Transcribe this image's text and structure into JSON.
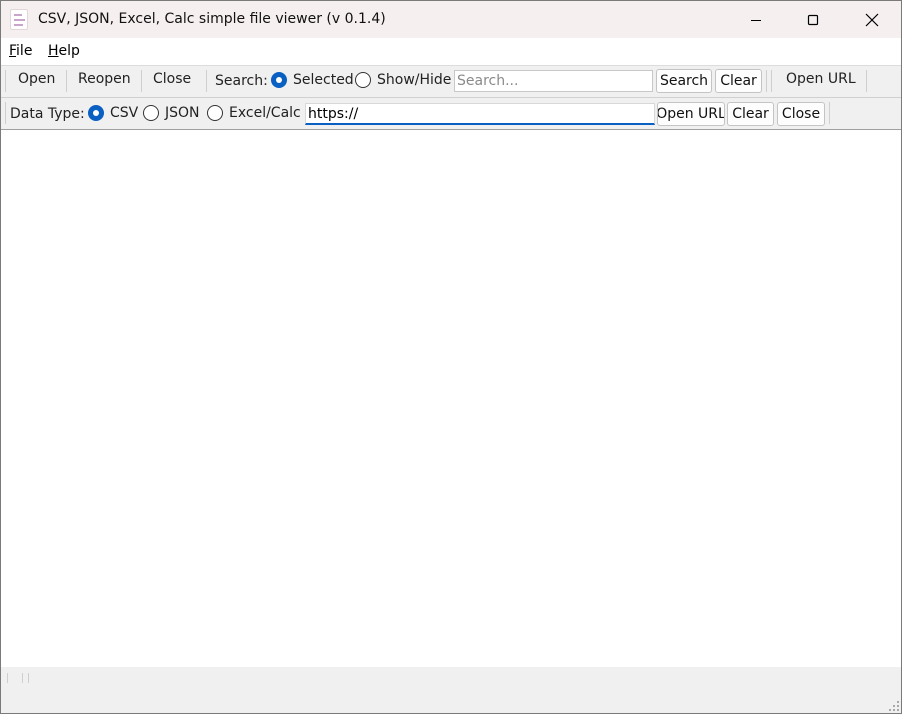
{
  "window": {
    "title": "CSV, JSON, Excel, Calc simple file viewer (v 0.1.4)"
  },
  "title_buttons": {
    "minimize": "minimize-icon",
    "maximize": "maximize-icon",
    "close": "close-icon"
  },
  "menu": {
    "file_u": "F",
    "file_rest": "ile",
    "help_u": "H",
    "help_rest": "elp"
  },
  "toolbar1": {
    "open": "Open",
    "reopen": "Reopen",
    "close": "Close",
    "search_label": "Search:",
    "search_mode_selected": "Selected",
    "search_mode_showhide": "Show/Hide",
    "search_mode_value": "Selected",
    "search_placeholder": "Search...",
    "search_value": "",
    "search_button": "Search",
    "clear_button": "Clear",
    "open_url": "Open URL"
  },
  "toolbar2": {
    "data_type_label": "Data Type:",
    "type_csv": "CSV",
    "type_json": "JSON",
    "type_excel": "Excel/Calc",
    "selected_type": "CSV",
    "url_value": "https://",
    "open_url_button": "Open URL",
    "clear_button": "Clear",
    "close_button": "Close"
  },
  "colors": {
    "accent": "#0a5fc2",
    "titlebar": "#f6eff0",
    "chrome": "#f0f0f0"
  }
}
